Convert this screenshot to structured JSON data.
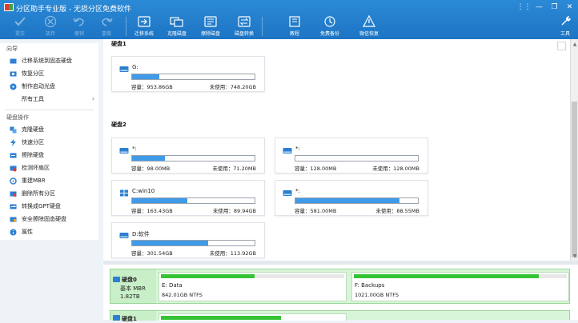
{
  "app": {
    "title": "分区助手专业版 - 无损分区免费软件",
    "window_controls": [
      "⋮⋮",
      "—",
      "❐",
      "✕"
    ]
  },
  "toolbar": {
    "left": [
      {
        "name": "commit",
        "label": "提交",
        "icon": "check-icon",
        "enabled": false
      },
      {
        "name": "discard",
        "label": "放弃",
        "icon": "x-circle-icon",
        "enabled": false
      },
      {
        "name": "undo",
        "label": "撤销",
        "icon": "undo-icon",
        "enabled": false
      },
      {
        "name": "redo",
        "label": "重做",
        "icon": "redo-icon",
        "enabled": false
      }
    ],
    "middle": [
      {
        "name": "migrate-os",
        "label": "迁移系统",
        "icon": "migrate-icon"
      },
      {
        "name": "clone-disk",
        "label": "克隆磁盘",
        "icon": "clone-icon"
      },
      {
        "name": "wipe-disk",
        "label": "擦除磁盘",
        "icon": "wipe-icon"
      },
      {
        "name": "disk-convert",
        "label": "磁盘转换",
        "icon": "convert-icon"
      }
    ],
    "right": [
      {
        "name": "tutorial",
        "label": "教程",
        "icon": "book-icon"
      },
      {
        "name": "free-backup",
        "label": "免费备份",
        "icon": "backup-icon"
      },
      {
        "name": "wechat-restore",
        "label": "微信恢复",
        "icon": "restore-icon"
      }
    ],
    "tools_label": "工具"
  },
  "sidebar": {
    "wizard_header": "向导",
    "wizard_items": [
      {
        "label": "迁移系统到固态硬盘",
        "icon": "migrate-ssd-icon"
      },
      {
        "label": "恢复分区",
        "icon": "recover-icon"
      },
      {
        "label": "制作启动光盘",
        "icon": "bootdisc-icon"
      },
      {
        "label": "所有工具",
        "icon": "tools-icon",
        "arrow": "›"
      }
    ],
    "disk_ops_header": "硬盘操作",
    "disk_ops_items": [
      {
        "label": "克隆硬盘",
        "icon": "clone-disk-icon"
      },
      {
        "label": "快速分区",
        "icon": "quick-partition-icon"
      },
      {
        "label": "擦除硬盘",
        "icon": "wipe-disk-icon"
      },
      {
        "label": "检测坏扇区",
        "icon": "bad-sector-icon"
      },
      {
        "label": "重建MBR",
        "icon": "rebuild-mbr-icon"
      },
      {
        "label": "删除所有分区",
        "icon": "delete-all-icon"
      },
      {
        "label": "转换成GPT硬盘",
        "icon": "convert-gpt-icon"
      },
      {
        "label": "安全擦除固态硬盘",
        "icon": "secure-erase-icon"
      },
      {
        "label": "属性",
        "icon": "info-icon"
      }
    ]
  },
  "main": {
    "disk1_label": "硬盘1",
    "disk2_label": "硬盘2",
    "partitions": [
      {
        "name": "G:",
        "capacity": "容量：953.86GB",
        "free": "未使用：748.20GB",
        "used_pct": 22,
        "icon": "drive-icon"
      },
      {
        "name": "*:",
        "capacity": "容量：98.00MB",
        "free": "未使用：71.20MB",
        "used_pct": 27,
        "icon": "drive-icon"
      },
      {
        "name": "*:",
        "capacity": "容量：128.00MB",
        "free": "未使用：128.00MB",
        "used_pct": 0,
        "icon": "drive-icon"
      },
      {
        "name": "C:win10",
        "capacity": "容量：163.43GB",
        "free": "未使用：89.94GB",
        "used_pct": 45,
        "icon": "windows-icon"
      },
      {
        "name": "*:",
        "capacity": "容量：581.00MB",
        "free": "未使用：88.55MB",
        "used_pct": 85,
        "icon": "drive-icon"
      },
      {
        "name": "D:软件",
        "capacity": "容量：301.54GB",
        "free": "未使用：113.92GB",
        "used_pct": 62,
        "icon": "drive-icon"
      }
    ]
  },
  "diskmap": {
    "disk0": {
      "name": "硬盘0",
      "type": "基本 MBR",
      "size": "1.82TB",
      "parts": [
        {
          "name": "E: Data",
          "info": "842.01GB NTFS",
          "used_pct": 52
        },
        {
          "name": "F: Backups",
          "info": "1021.00GB NTFS",
          "used_pct": 87
        }
      ]
    },
    "disk1": {
      "name": "硬盘1"
    }
  },
  "colors": {
    "toolbar": "#1d74c4",
    "bar_fill": "#3f9be8",
    "map_used": "#35c435"
  }
}
